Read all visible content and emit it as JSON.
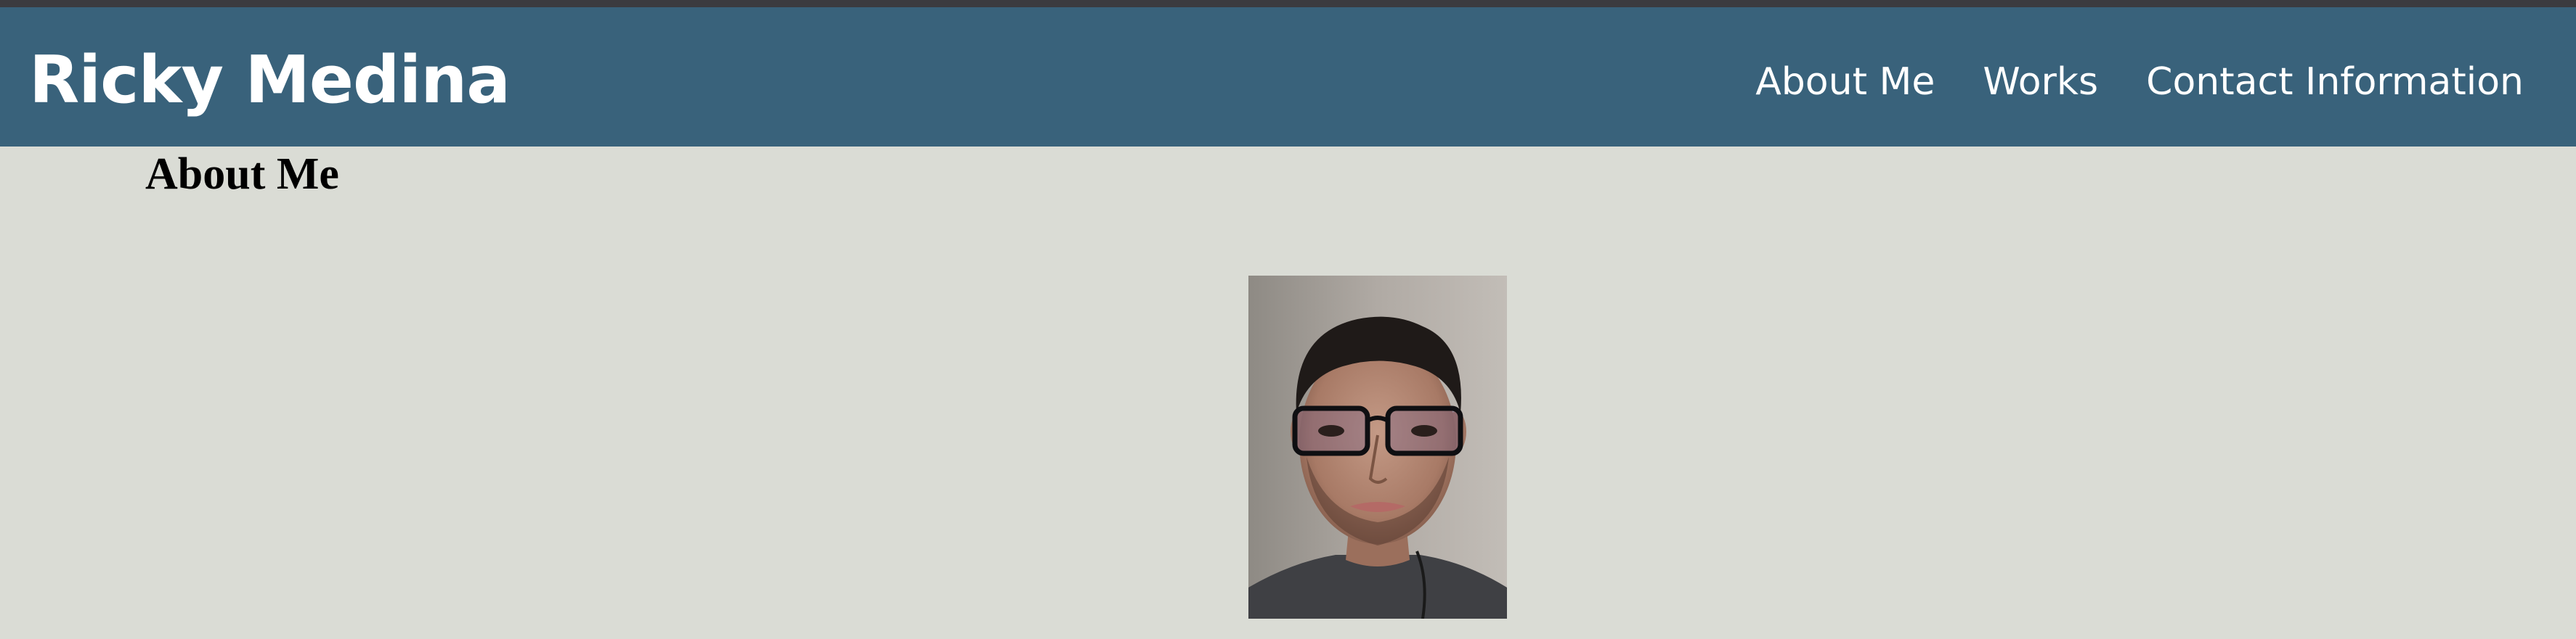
{
  "header": {
    "brand": "Ricky Medina",
    "nav": [
      {
        "label": "About Me"
      },
      {
        "label": "Works"
      },
      {
        "label": "Contact Information"
      }
    ]
  },
  "main": {
    "section_title": "About Me",
    "portrait": {
      "subject": "portrait photo of a person wearing glasses"
    }
  },
  "colors": {
    "header_bg": "#39627b",
    "page_bg": "#dadcd5",
    "top_strip": "#3b3b3f",
    "header_text": "#ffffff",
    "title_text": "#000000"
  }
}
